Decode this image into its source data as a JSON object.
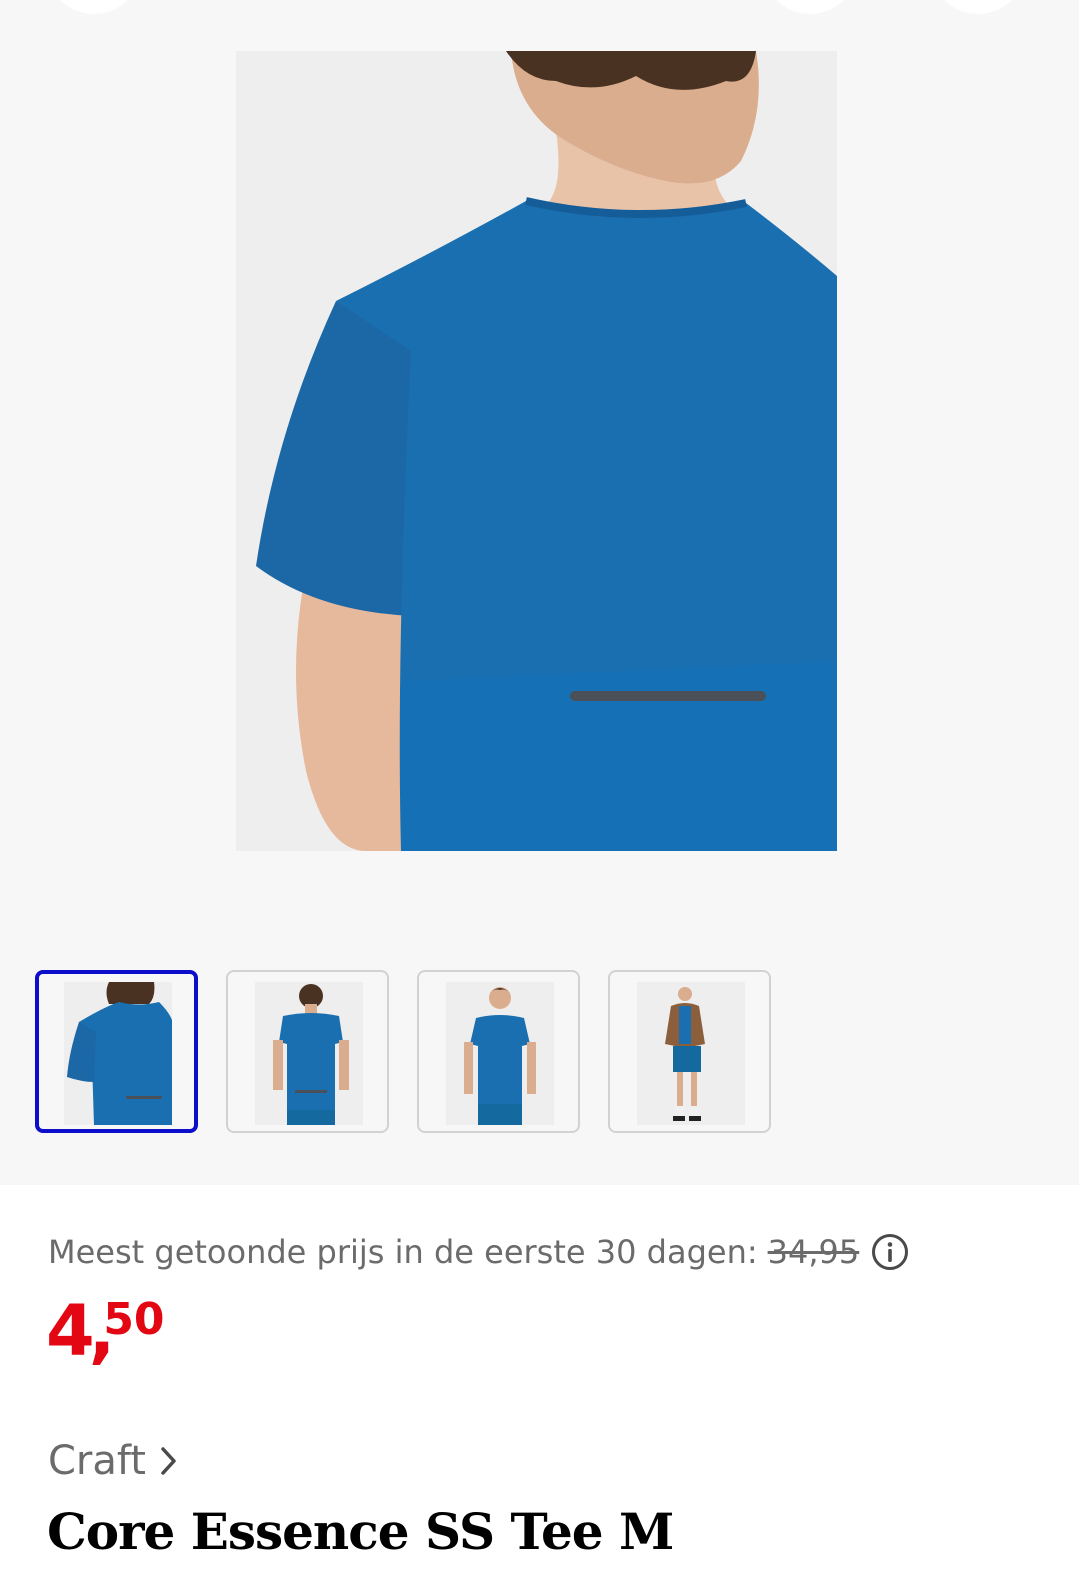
{
  "gallery": {
    "main_image": "product-photo-back-closeup",
    "thumbnails": [
      {
        "image": "back-closeup",
        "selected": true
      },
      {
        "image": "back-full",
        "selected": false
      },
      {
        "image": "front-full",
        "selected": false
      },
      {
        "image": "jacket-outfit",
        "selected": false
      }
    ]
  },
  "pricing": {
    "reference_label": "Meest getoonde prijs in de eerste 30 dagen:",
    "reference_price": "34,95",
    "price_euros": "4",
    "price_sep": ",",
    "price_cents": "50",
    "price_color": "#e30613"
  },
  "product": {
    "brand": "Craft",
    "title": "Core Essence SS Tee M"
  },
  "colors": {
    "selected_border": "#0d0dcc",
    "shirt_blue": "#1a6fb0"
  }
}
